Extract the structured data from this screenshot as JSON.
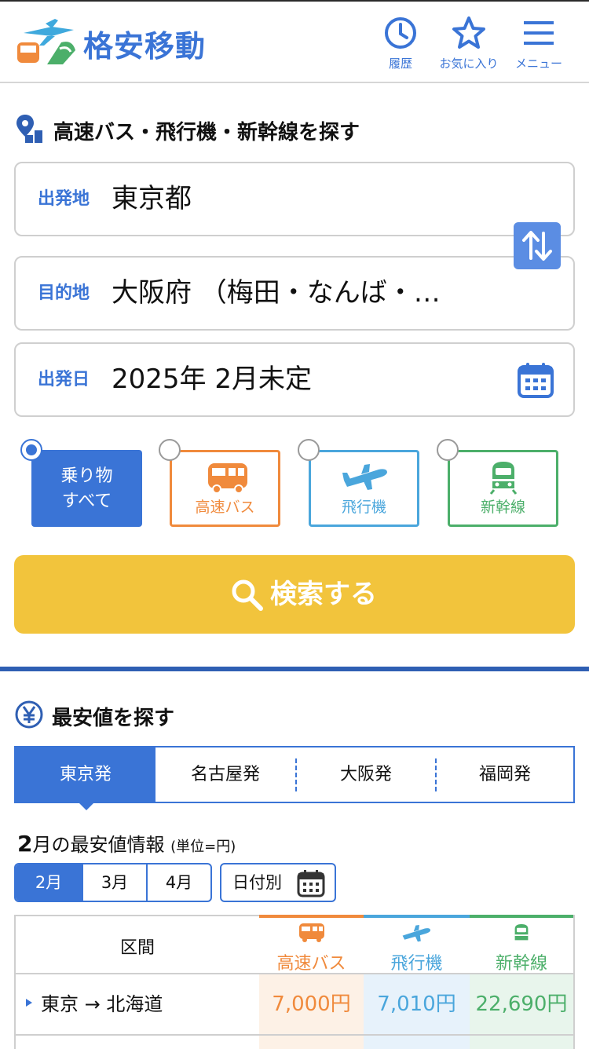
{
  "app": {
    "name": "格安移動"
  },
  "header": {
    "history_label": "履歴",
    "favorites_label": "お気に入り",
    "menu_label": "メニュー"
  },
  "search": {
    "title": "高速バス・飛行機・新幹線を探す",
    "departure": {
      "key": "出発地",
      "value": "東京都"
    },
    "destination": {
      "key": "目的地",
      "value": "大阪府 （梅田・なんば・…"
    },
    "date": {
      "key": "出発日",
      "value": "2025年 2月未定"
    },
    "modes": [
      {
        "label": "乗り物\nすべて",
        "selected": true
      },
      {
        "label": "高速バス",
        "selected": false
      },
      {
        "label": "飛行機",
        "selected": false
      },
      {
        "label": "新幹線",
        "selected": false
      }
    ],
    "mode_all_line1": "乗り物",
    "mode_all_line2": "すべて",
    "submit_label": "検索する"
  },
  "cheapest": {
    "title": "最安値を探す",
    "tabs": [
      "東京発",
      "名古屋発",
      "大阪発",
      "福岡発"
    ],
    "active_tab": "東京発",
    "info_month": "2",
    "info_text": "月の最安値情報",
    "info_unit": "(単位=円)",
    "months": [
      "2月",
      "3月",
      "4月"
    ],
    "active_month": "2月",
    "by_date_label": "日付別",
    "table": {
      "headers": [
        "区間",
        "高速バス",
        "飛行機",
        "新幹線"
      ],
      "rows": [
        {
          "route": "東京 → 北海道",
          "bus": "7,000円",
          "plane": "7,010円",
          "train": "22,690円"
        }
      ]
    }
  },
  "colors": {
    "primary": "#3a74d6",
    "bus": "#f08a3c",
    "plane": "#4aa6dc",
    "train": "#4caf6a",
    "search_button": "#f2c43c"
  }
}
